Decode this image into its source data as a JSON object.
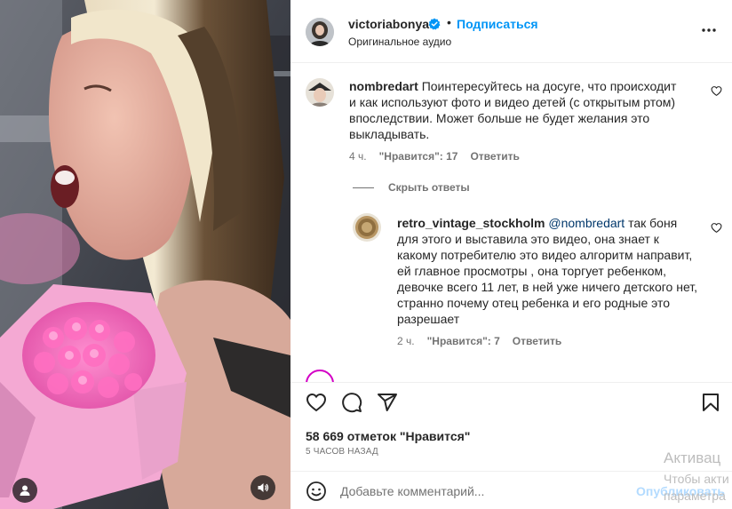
{
  "post": {
    "author": "victoriabonya",
    "follow_label": "Подписаться",
    "separator": "•",
    "audio": "Оригинальное аудио",
    "likes_text": "58 669 отметок \"Нравится\"",
    "time_ago": "5 ЧАСОВ НАЗАД"
  },
  "comments": [
    {
      "username": "nombredart",
      "text": "Поинтересуйтесь на досуге, что происходит и как используют фото и видео детей (с открытым ртом) впоследствии. Может больше не будет желания это выкладывать.",
      "time": "4 ч.",
      "likes": "\"Нравится\": 17",
      "reply_label": "Ответить"
    }
  ],
  "hide_replies_label": "Скрыть ответы",
  "replies": [
    {
      "username": "retro_vintage_stockholm",
      "mention": "@nombredart",
      "text": "так боня для этого и выставила это видео, она знает к какому потребителю это видео алгоритм направит, ей главное просмотры , она торгует ребенком, девочке всего 11 лет, в ней уже ничего детского нет, странно почему отец ребенка и его родные это разрешает",
      "time": "2 ч.",
      "likes": "\"Нравится\": 7",
      "reply_label": "Ответить"
    }
  ],
  "composer": {
    "placeholder": "Добавьте комментарий...",
    "publish_label": "Опубликовать"
  },
  "watermark": {
    "line1": "Активац",
    "line2": "Чтобы акти",
    "line3": "параметра"
  },
  "icons": {
    "more": "more-options-icon",
    "like": "heart-icon",
    "comment": "comment-icon",
    "share": "share-icon",
    "save": "bookmark-icon",
    "emoji": "emoji-icon",
    "user_tag": "user-icon",
    "audio": "speaker-icon",
    "verified": "verified-badge-icon"
  },
  "colors": {
    "accent": "#0095f6",
    "publish_disabled": "#b3dbff",
    "secondary_text": "#737373"
  }
}
